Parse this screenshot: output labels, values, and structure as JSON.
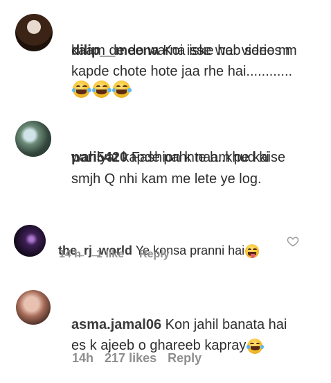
{
  "comments": [
    {
      "username": "dilip__meena",
      "text_line1": " Koi isse web series m",
      "text_lines": "kaam de do warna iske har video m\nkapde chote hote jaa rhe hai............",
      "emoji_icon": "face-with-tears-of-joy-icon"
    },
    {
      "username": "pari5420",
      "text_line1": " Fashion k naam pe kaise",
      "text_lines": "wahiyat kapde pahnte h..khud ki\nsmjh Q nhi kam me lete ye log."
    },
    {
      "username": "the_rj_world",
      "text_line1": " Ye konsa pranni hai",
      "emoji_icon": "face-with-tongue-icon",
      "time": "14 h",
      "likes": "1 like",
      "reply": "Reply",
      "like_icon": "heart-outline-icon"
    },
    {
      "username": "asma.jamal06",
      "text_line1": " Kon jahil banata hai",
      "text_lines": "es k ajeeb o ghareeb kapray",
      "emoji_icon": "face-with-tears-of-joy-icon",
      "time": "14h",
      "likes": "217 likes",
      "reply": "Reply"
    }
  ]
}
